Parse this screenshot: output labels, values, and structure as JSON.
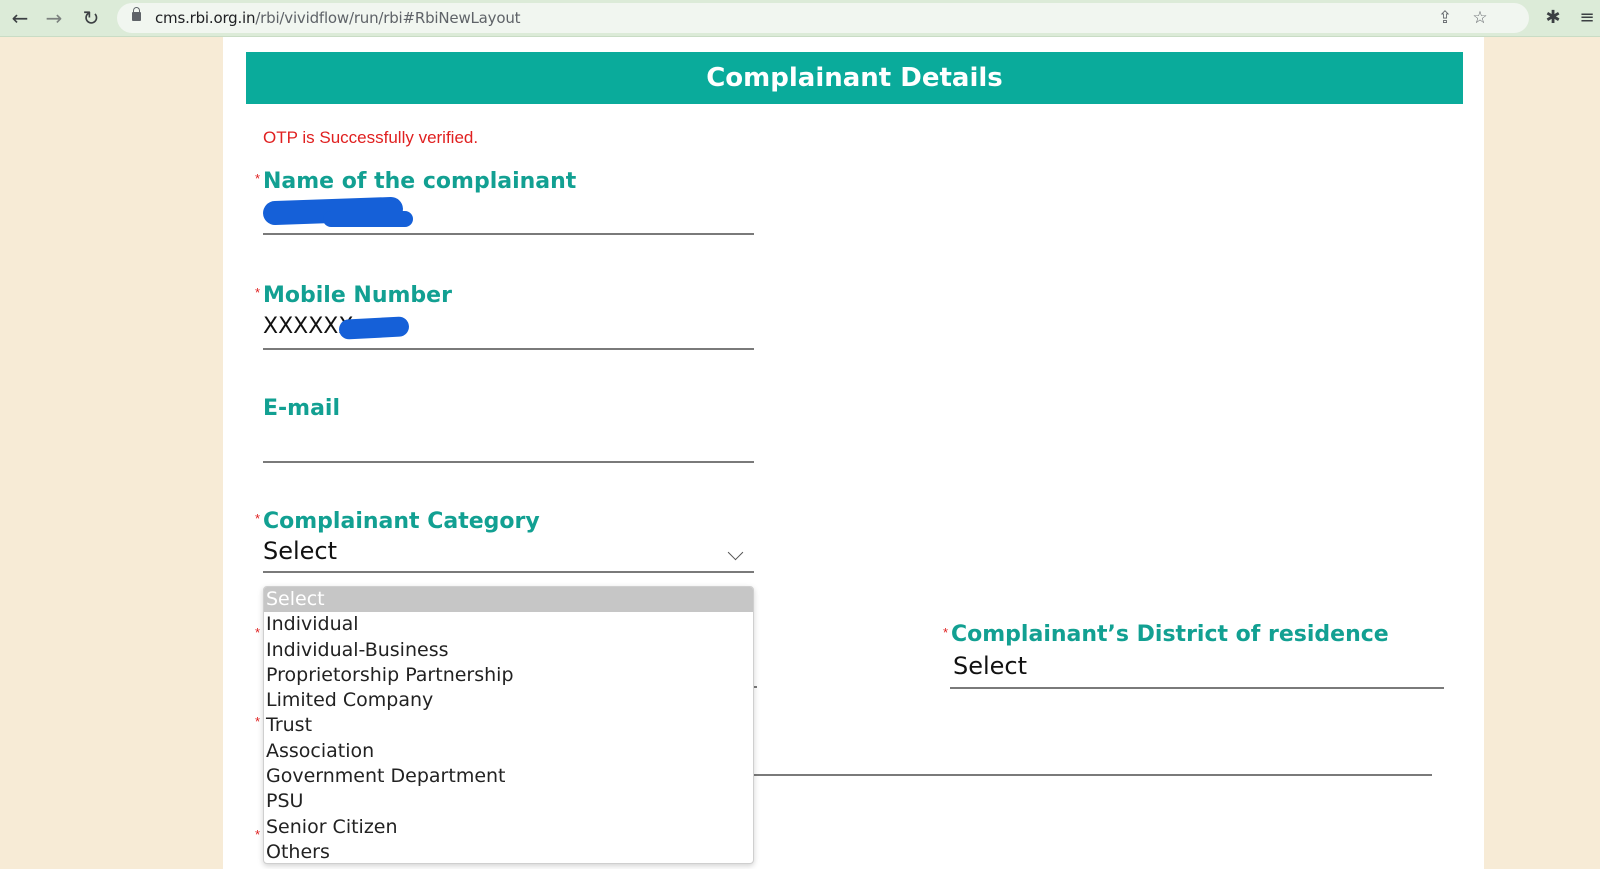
{
  "browser": {
    "url_host": "cms.rbi.org.in",
    "url_path": "/rbi/vividflow/run/rbi#RbiNewLayout"
  },
  "form": {
    "title": "Complainant Details",
    "otp_message": "OTP is Successfully verified.",
    "required_mark": "*",
    "name_label": "Name of the complainant",
    "mobile_label": "Mobile Number",
    "mobile_value_visible": "XXXXXX",
    "email_label": "E-mail",
    "email_value": "",
    "category_label": "Complainant Category",
    "category_value": "Select",
    "district_label": "Complainant’s District of residence",
    "district_value": "Select"
  },
  "category_options": [
    "Select",
    "Individual",
    "Individual-Business",
    "Proprietorship Partnership",
    "Limited Company",
    "Trust",
    "Association",
    "Government Department",
    "PSU",
    "Senior Citizen",
    "Others"
  ],
  "colors": {
    "header_bg": "#0aab9b",
    "label": "#12a092",
    "error": "#e02020",
    "page_bg": "#f7ebd6",
    "redaction": "#1560d8"
  }
}
